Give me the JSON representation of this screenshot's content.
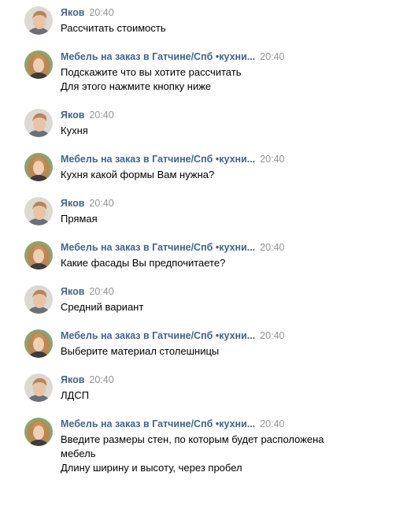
{
  "messages": [
    {
      "author": "Яков",
      "time": "20:40",
      "avatar": "male-avatar",
      "lines": [
        "Рассчитать стоимость"
      ]
    },
    {
      "author": "Мебель на заказ в Гатчине/Спб •кухни...",
      "time": "20:40",
      "avatar": "female-avatar",
      "lines": [
        "Подскажите что вы хотите рассчитать",
        "Для этого нажмите кнопку ниже"
      ]
    },
    {
      "author": "Яков",
      "time": "20:40",
      "avatar": "male-avatar",
      "lines": [
        "Кухня"
      ]
    },
    {
      "author": "Мебель на заказ в Гатчине/Спб •кухни...",
      "time": "20:40",
      "avatar": "female-avatar",
      "lines": [
        "Кухня какой формы Вам нужна?"
      ]
    },
    {
      "author": "Яков",
      "time": "20:40",
      "avatar": "male-avatar",
      "lines": [
        "Прямая"
      ]
    },
    {
      "author": "Мебель на заказ в Гатчине/Спб •кухни...",
      "time": "20:40",
      "avatar": "female-avatar",
      "lines": [
        "Какие фасады Вы предпочитаете?"
      ]
    },
    {
      "author": "Яков",
      "time": "20:40",
      "avatar": "male-avatar",
      "lines": [
        "Средний вариант"
      ]
    },
    {
      "author": "Мебель на заказ в Гатчине/Спб •кухни...",
      "time": "20:40",
      "avatar": "female-avatar",
      "lines": [
        "Выберите материал столешницы"
      ]
    },
    {
      "author": "Яков",
      "time": "20:40",
      "avatar": "male-avatar",
      "lines": [
        "ЛДСП"
      ]
    },
    {
      "author": "Мебель на заказ в Гатчине/Спб •кухни...",
      "time": "20:40",
      "avatar": "female-avatar",
      "lines": [
        "Введите размеры стен, по которым будет расположена",
        "мебель",
        "Длину ширину и высоту, через пробел"
      ]
    }
  ],
  "colors": {
    "author": "#42648b",
    "time": "#939393",
    "text": "#000000",
    "background": "#ffffff"
  }
}
